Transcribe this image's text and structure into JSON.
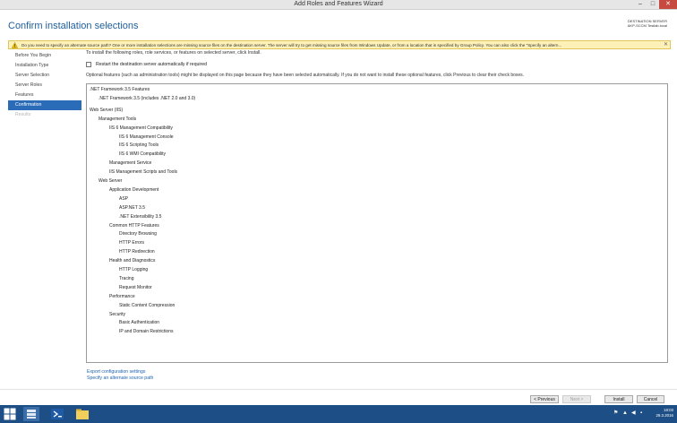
{
  "window": {
    "title": "Add Roles and Features Wizard",
    "controls": {
      "minimize": "–",
      "maximize": "□",
      "close": "✕"
    }
  },
  "header": {
    "page_title": "Confirm installation selections",
    "destination_label": "DESTINATION SERVER",
    "destination_value": "AKP-SCCM.Testlab.local"
  },
  "warning": {
    "text": "Do you need to specify an alternate source path? One or more installation selections are missing source files on the destination server. The server will try to get missing source files from Windows Update, or from a location that is specified by Group Policy. You can also click the \"Specify an altern...",
    "close": "✕"
  },
  "nav": {
    "items": [
      {
        "label": "Before You Begin",
        "state": "normal"
      },
      {
        "label": "Installation Type",
        "state": "normal"
      },
      {
        "label": "Server Selection",
        "state": "normal"
      },
      {
        "label": "Server Roles",
        "state": "normal"
      },
      {
        "label": "Features",
        "state": "normal"
      },
      {
        "label": "Confirmation",
        "state": "active"
      },
      {
        "label": "Results",
        "state": "disabled"
      }
    ]
  },
  "content": {
    "intro": "To install the following roles, role services, or features on selected server, click Install.",
    "restart_label": "Restart the destination server automatically if required",
    "restart_checked": false,
    "optional_note": "Optional features (such as administration tools) might be displayed on this page because they have been selected automatically. If you do not want to install these optional features, click Previous to clear their check boxes."
  },
  "tree": [
    {
      "label": ".NET Framework 3.5 Features",
      "level": 0
    },
    {
      "label": ".NET Framework 3.5 (includes .NET 2.0 and 3.0)",
      "level": 1
    },
    {
      "label": "Web Server (IIS)",
      "level": 0
    },
    {
      "label": "Management Tools",
      "level": 1
    },
    {
      "label": "IIS 6 Management Compatibility",
      "level": 2
    },
    {
      "label": "IIS 6 Management Console",
      "level": 3
    },
    {
      "label": "IIS 6 Scripting Tools",
      "level": 3
    },
    {
      "label": "IIS 6 WMI Compatibility",
      "level": 3
    },
    {
      "label": "Management Service",
      "level": 2
    },
    {
      "label": "IIS Management Scripts and Tools",
      "level": 2
    },
    {
      "label": "Web Server",
      "level": 1
    },
    {
      "label": "Application Development",
      "level": 2
    },
    {
      "label": "ASP",
      "level": 3
    },
    {
      "label": "ASP.NET 3.5",
      "level": 3
    },
    {
      "label": ".NET Extensibility 3.5",
      "level": 3
    },
    {
      "label": "Common HTTP Features",
      "level": 2
    },
    {
      "label": "Directory Browsing",
      "level": 3
    },
    {
      "label": "HTTP Errors",
      "level": 3
    },
    {
      "label": "HTTP Redirection",
      "level": 3
    },
    {
      "label": "Health and Diagnostics",
      "level": 2
    },
    {
      "label": "HTTP Logging",
      "level": 3
    },
    {
      "label": "Tracing",
      "level": 3
    },
    {
      "label": "Request Monitor",
      "level": 3
    },
    {
      "label": "Performance",
      "level": 2
    },
    {
      "label": "Static Content Compression",
      "level": 3
    },
    {
      "label": "Security",
      "level": 2
    },
    {
      "label": "Basic Authentication",
      "level": 3
    },
    {
      "label": "IP and Domain Restrictions",
      "level": 3
    }
  ],
  "links": {
    "export": "Export configuration settings",
    "alt_source": "Specify an alternate source path"
  },
  "buttons": {
    "previous": "< Previous",
    "next": "Next >",
    "install": "Install",
    "cancel": "Cancel"
  },
  "taskbar": {
    "time": "18:03",
    "date": "29.3.2016"
  },
  "colors": {
    "accent": "#2b6cb8",
    "title_blue": "#1e5e9e",
    "warning_bg": "#fdf1b8",
    "taskbar": "#1d4f86"
  }
}
